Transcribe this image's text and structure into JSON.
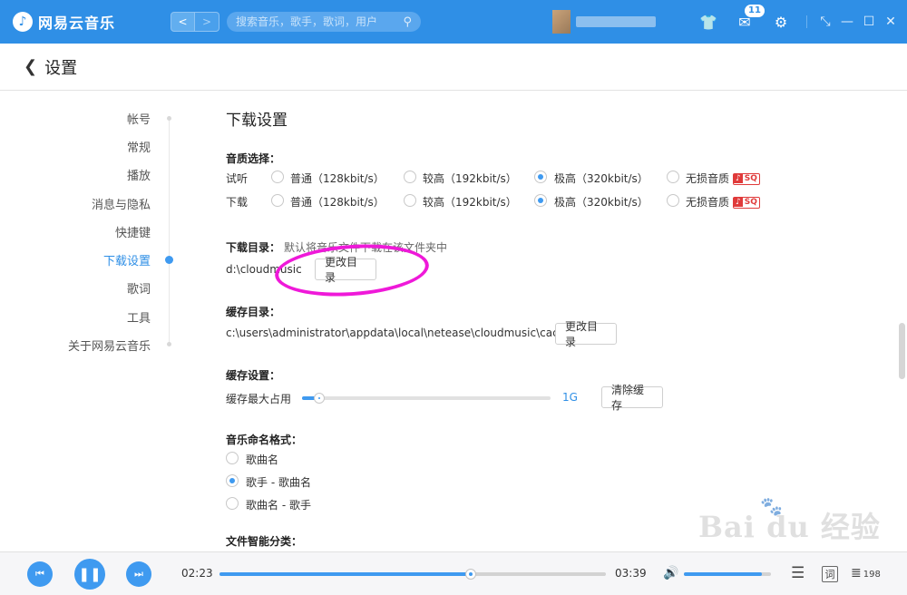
{
  "app": {
    "name": "网易云音乐",
    "search_placeholder": "搜索音乐，歌手，歌词，用户",
    "message_badge": "11"
  },
  "header": {
    "title": "设置"
  },
  "sidebar": {
    "items": [
      {
        "label": "帐号"
      },
      {
        "label": "常规"
      },
      {
        "label": "播放"
      },
      {
        "label": "消息与隐私"
      },
      {
        "label": "快捷键"
      },
      {
        "label": "下载设置"
      },
      {
        "label": "歌词"
      },
      {
        "label": "工具"
      },
      {
        "label": "关于网易云音乐"
      }
    ],
    "active_index": 5
  },
  "download": {
    "section_title": "下载设置",
    "quality_label": "音质选择：",
    "rows": [
      {
        "label": "试听",
        "selected": 2
      },
      {
        "label": "下载",
        "selected": 2
      }
    ],
    "options": [
      "普通（128kbit/s）",
      "较高（192kbit/s）",
      "极高（320kbit/s）",
      "无损音质"
    ],
    "sq_badge": "SQ",
    "dir_label": "下载目录：",
    "dir_hint": "默认将音乐文件下载在该文件夹中",
    "dir_path": "d:\\cloudmusic",
    "change_dir_button": "更改目录"
  },
  "cache": {
    "dir_label": "缓存目录：",
    "dir_path": "c:\\users\\administrator\\appdata\\local\\netease\\cloudmusic\\cache",
    "change_dir_button": "更改目录",
    "settings_label": "缓存设置：",
    "max_label": "缓存最大占用",
    "max_value": "1G",
    "slider_fraction": 0.07,
    "clear_button": "清除缓存"
  },
  "naming": {
    "label": "音乐命名格式：",
    "options": [
      "歌曲名",
      "歌手 - 歌曲名",
      "歌曲名 - 歌手"
    ],
    "selected": 1
  },
  "smart_sort": {
    "label": "文件智能分类："
  },
  "player": {
    "elapsed": "02:23",
    "total": "03:39",
    "progress_fraction": 0.65,
    "volume_fraction": 0.9,
    "lyric_label": "词",
    "playlist_count": "198"
  },
  "watermark": {
    "text": "Bai du 经验",
    "url": "jingyan.baidu.com"
  },
  "colors": {
    "accent": "#2f8fe6",
    "annotation": "#ef19d9"
  }
}
